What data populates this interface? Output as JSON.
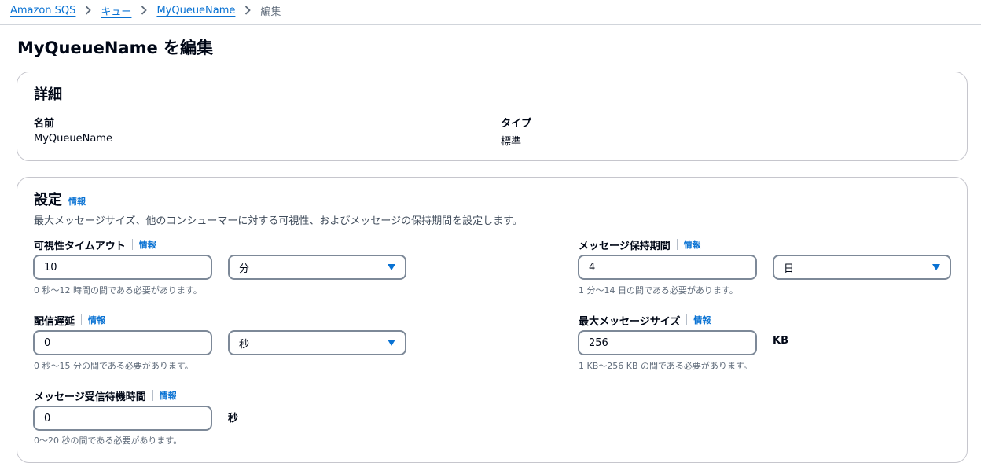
{
  "breadcrumb": {
    "items": [
      "Amazon SQS",
      "キュー",
      "MyQueueName"
    ],
    "current": "編集"
  },
  "page": {
    "title": "MyQueueName を編集"
  },
  "details": {
    "heading": "詳細",
    "name_label": "名前",
    "name_value": "MyQueueName",
    "type_label": "タイプ",
    "type_value": "標準"
  },
  "config": {
    "heading": "設定",
    "info": "情報",
    "description": "最大メッセージサイズ、他のコンシューマーに対する可視性、およびメッセージの保持期間を設定します。",
    "visibility_timeout": {
      "label": "可視性タイムアウト",
      "info": "情報",
      "value": "10",
      "unit": "分",
      "hint": "0 秒〜12 時間の間である必要があります。"
    },
    "retention_period": {
      "label": "メッセージ保持期間",
      "info": "情報",
      "value": "4",
      "unit": "日",
      "hint": "1 分〜14 日の間である必要があります。"
    },
    "delivery_delay": {
      "label": "配信遅延",
      "info": "情報",
      "value": "0",
      "unit": "秒",
      "hint": "0 秒〜15 分の間である必要があります。"
    },
    "max_message_size": {
      "label": "最大メッセージサイズ",
      "info": "情報",
      "value": "256",
      "unit": "KB",
      "hint": "1 KB〜256 KB の間である必要があります。"
    },
    "receive_wait_time": {
      "label": "メッセージ受信待機時間",
      "info": "情報",
      "value": "0",
      "unit": "秒",
      "hint": "0〜20 秒の間である必要があります。"
    }
  },
  "colors": {
    "link": "#0972d3",
    "text": "#000716",
    "muted": "#5f6b7a",
    "border": "#7d8998"
  }
}
